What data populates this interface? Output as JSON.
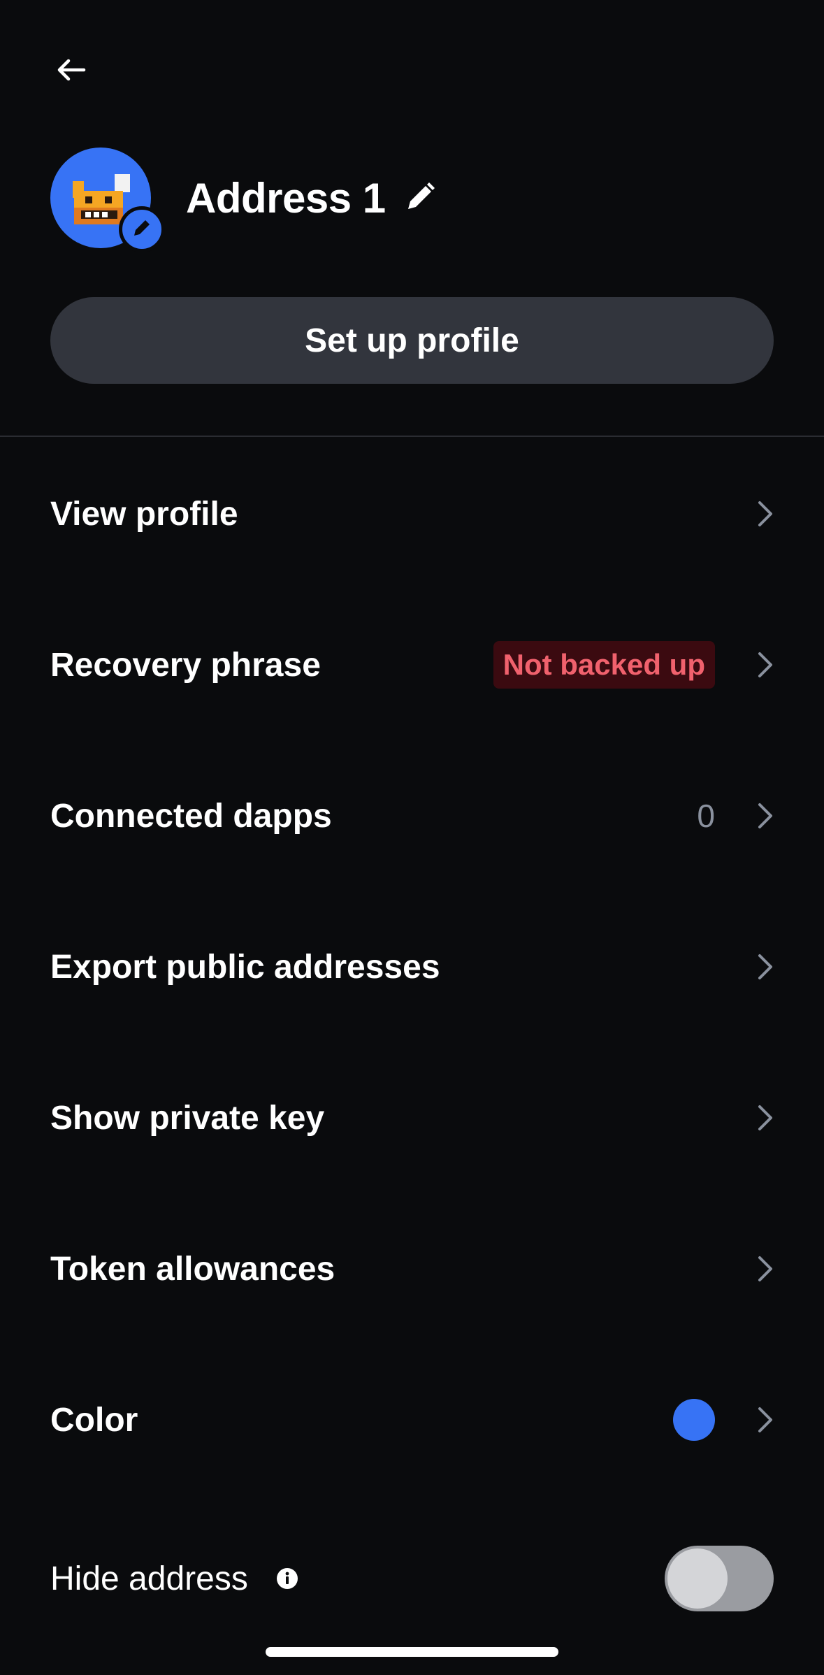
{
  "header": {
    "back_icon": "arrow-left-icon",
    "address_name": "Address 1",
    "name_edit_icon": "pencil-icon",
    "avatar_edit_icon": "pencil-icon"
  },
  "setup_button": {
    "label": "Set up profile"
  },
  "menu": {
    "items": [
      {
        "label": "View profile"
      },
      {
        "label": "Recovery phrase",
        "badge": "Not backed up"
      },
      {
        "label": "Connected dapps",
        "count": "0"
      },
      {
        "label": "Export public addresses"
      },
      {
        "label": "Show private key"
      },
      {
        "label": "Token allowances"
      },
      {
        "label": "Color",
        "color": "#3773f5"
      }
    ],
    "chevron_icon": "chevron-right-icon"
  },
  "hide_address": {
    "label": "Hide address",
    "info_icon": "info-icon",
    "toggle_on": false
  },
  "colors": {
    "background": "#0a0b0d",
    "accent": "#3773f5",
    "button_bg": "#32353d",
    "warning_text": "#f0616d",
    "warning_bg": "#3b0a10"
  }
}
